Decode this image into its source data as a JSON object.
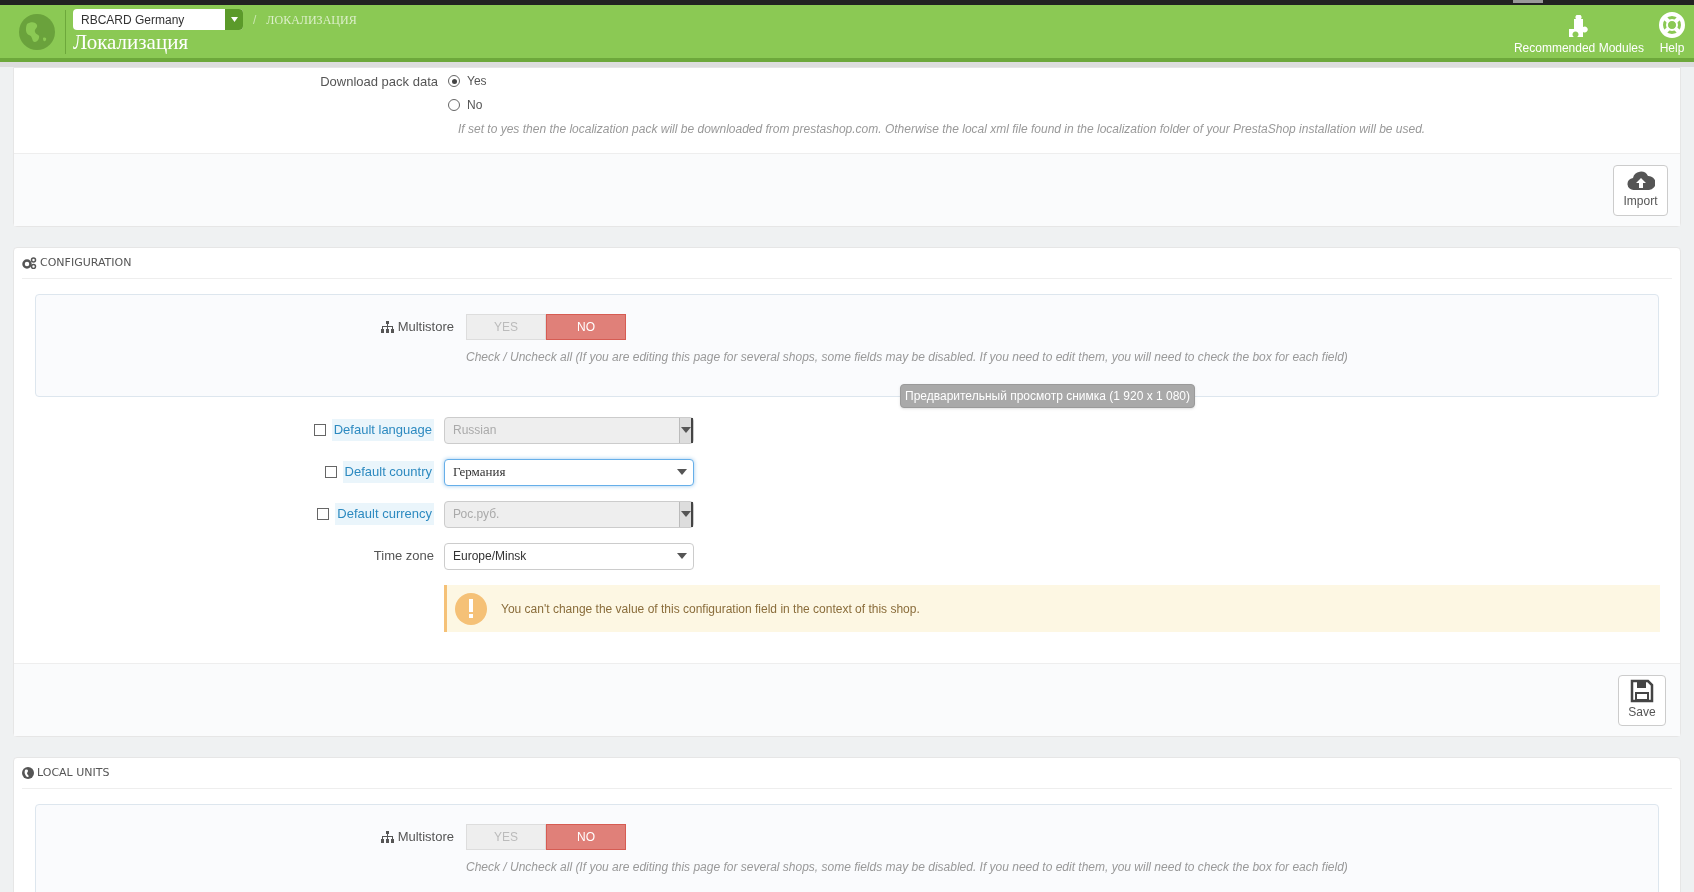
{
  "header": {
    "shop_selector": {
      "value": "RBCARD Germany"
    },
    "breadcrumb_separator": "/",
    "breadcrumb": "ЛОКАЛИЗАЦИЯ",
    "title": "Локализация",
    "toolbar": [
      {
        "kind": "modules",
        "label": "Recommended Modules"
      },
      {
        "kind": "help",
        "label": "Help"
      }
    ]
  },
  "import_panel": {
    "download_pack": {
      "label": "Download pack data",
      "options": [
        {
          "label": "Yes",
          "selected": true
        },
        {
          "label": "No",
          "selected": false
        }
      ],
      "help": "If set to yes then the localization pack will be downloaded from prestashop.com. Otherwise the local xml file found in the localization folder of your PrestaShop installation will be used."
    },
    "button": "Import"
  },
  "configuration": {
    "title": "CONFIGURATION",
    "multistore": {
      "label": "Multistore",
      "options": [
        {
          "label": "YES",
          "selected": false
        },
        {
          "label": "NO",
          "selected": true
        }
      ],
      "help": "Check / Uncheck all (If you are editing this page for several shops, some fields may be disabled. If you need to edit them, you will need to check the box for each field)"
    },
    "fields": [
      {
        "kind": "shop_field",
        "label": "Default language",
        "checked": false,
        "value": "Russian",
        "disabled": true
      },
      {
        "kind": "shop_field",
        "label": "Default country",
        "checked": false,
        "value": "Германия",
        "disabled": false
      },
      {
        "kind": "shop_field",
        "label": "Default currency",
        "checked": false,
        "value": "Рос.руб.",
        "disabled": true
      },
      {
        "kind": "plain",
        "label": "Time zone",
        "value": "Europe/Minsk",
        "disabled": false
      }
    ],
    "warning": "You can't change the value of this configuration field in the context of this shop.",
    "button": "Save"
  },
  "tooltip": "Предварительный просмотр снимка (1 920 x 1 080)",
  "local_units": {
    "title": "LOCAL UNITS",
    "multistore": {
      "label": "Multistore",
      "options": [
        {
          "label": "YES",
          "selected": false
        },
        {
          "label": "NO",
          "selected": true
        }
      ],
      "help": "Check / Uncheck all (If you are editing this page for several shops, some fields may be disabled. If you need to edit them, you will need to check the box for each field)"
    }
  }
}
